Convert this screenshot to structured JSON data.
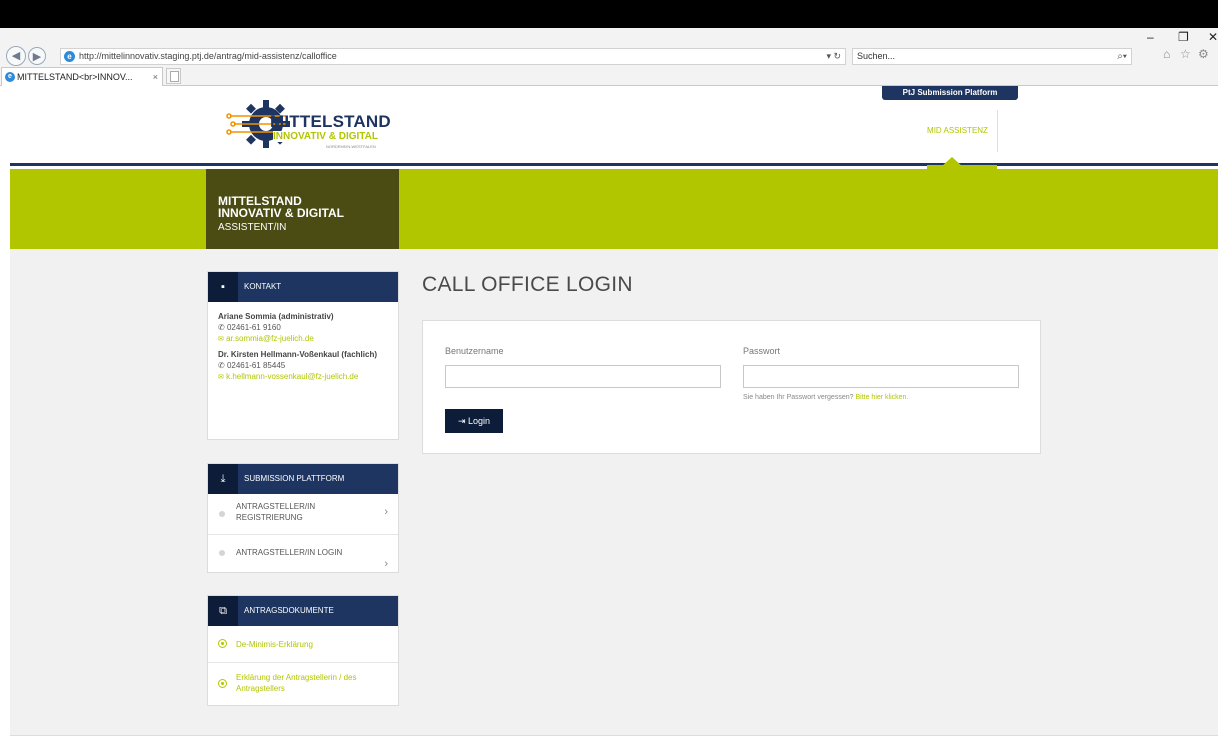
{
  "browser": {
    "url": "http://mittelinnovativ.staging.ptj.de/antrag/mid-assistenz/calloffice",
    "search_placeholder": "Suchen...",
    "tab_title": "MITTELSTAND<br>INNOV...",
    "window_controls": [
      "–",
      "❐",
      "✕"
    ],
    "toolbar_icons": [
      "home-icon",
      "star-icon",
      "gear-icon"
    ]
  },
  "header": {
    "logo_line1": "MITTELSTAND",
    "logo_line2": "INNOVATIV & DIGITAL",
    "logo_line3": "NORDRHEIN-WESTFALEN",
    "platform_tab": "PtJ Submission Platform",
    "nav_item": "MID ASSISTENZ"
  },
  "banner": {
    "line1": "MITTELSTAND",
    "line2": "INNOVATIV & DIGITAL",
    "line3": "ASSISTENT/IN"
  },
  "contact": {
    "title": "KONTAKT",
    "persons": [
      {
        "name": "Ariane Sommia (administrativ)",
        "phone": "02461-61 9160",
        "email": "ar.sommia@fz-juelich.de"
      },
      {
        "name": "Dr. Kirsten Hellmann-Voßenkaul (fachlich)",
        "phone": "02461-61 85445",
        "email": "k.hellmann-vossenkaul@fz-juelich.de"
      }
    ]
  },
  "submission": {
    "title": "SUBMISSION PLATTFORM",
    "items": [
      "ANTRAGSTELLER/IN REGISTRIERUNG",
      "ANTRAGSTELLER/IN LOGIN"
    ]
  },
  "documents": {
    "title": "ANTRAGSDOKUMENTE",
    "items": [
      "De-Minimis-Erklärung",
      "Erklärung der Antragstellerin / des Antragstellers"
    ]
  },
  "login": {
    "page_title": "CALL OFFICE LOGIN",
    "username_label": "Benutzername",
    "username_value": "",
    "password_label": "Passwort",
    "password_value": "",
    "forgot_text": "Sie haben Ihr Passwort vergessen?",
    "forgot_link": "Bitte hier klicken.",
    "button_label": "Login"
  },
  "colors": {
    "accent_green": "#b2c600",
    "navy": "#1d3560",
    "dark_olive": "#4b4b14"
  }
}
